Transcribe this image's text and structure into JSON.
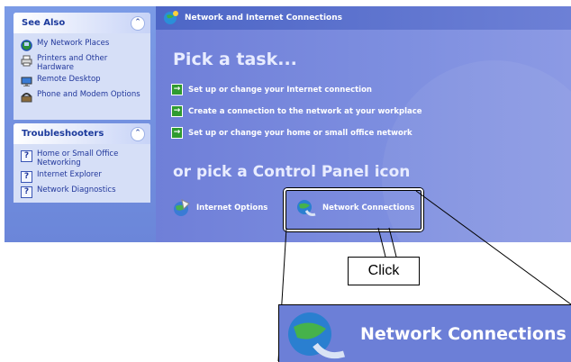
{
  "see_also": {
    "title": "See Also",
    "items": [
      {
        "label": "My Network Places",
        "icon": "network-places-icon"
      },
      {
        "label": "Printers and Other Hardware",
        "icon": "printer-icon"
      },
      {
        "label": "Remote Desktop",
        "icon": "remote-desktop-icon"
      },
      {
        "label": "Phone and Modem Options",
        "icon": "phone-icon"
      }
    ]
  },
  "troubleshooters": {
    "title": "Troubleshooters",
    "items": [
      {
        "label": "Home or Small Office Networking",
        "icon": "help-icon"
      },
      {
        "label": "Internet Explorer",
        "icon": "help-icon"
      },
      {
        "label": "Network Diagnostics",
        "icon": "help-icon"
      }
    ]
  },
  "main": {
    "title": "Network and Internet Connections",
    "pick_task": "Pick a task...",
    "tasks": [
      "Set up or change your Internet connection",
      "Create a connection to the network at your workplace",
      "Set up or change your home or small office network"
    ],
    "pick_icon": "or pick a Control Panel icon",
    "icons": [
      {
        "label": "Internet Options",
        "icon": "internet-options-icon"
      },
      {
        "label": "Network Connections",
        "icon": "network-connections-icon"
      }
    ]
  },
  "callout": {
    "click_label": "Click",
    "zoom_label": "Network Connections"
  },
  "colors": {
    "pane_blue": "#6f7fd8",
    "task_green": "#2f9b2f",
    "link_blue": "#21379b"
  }
}
